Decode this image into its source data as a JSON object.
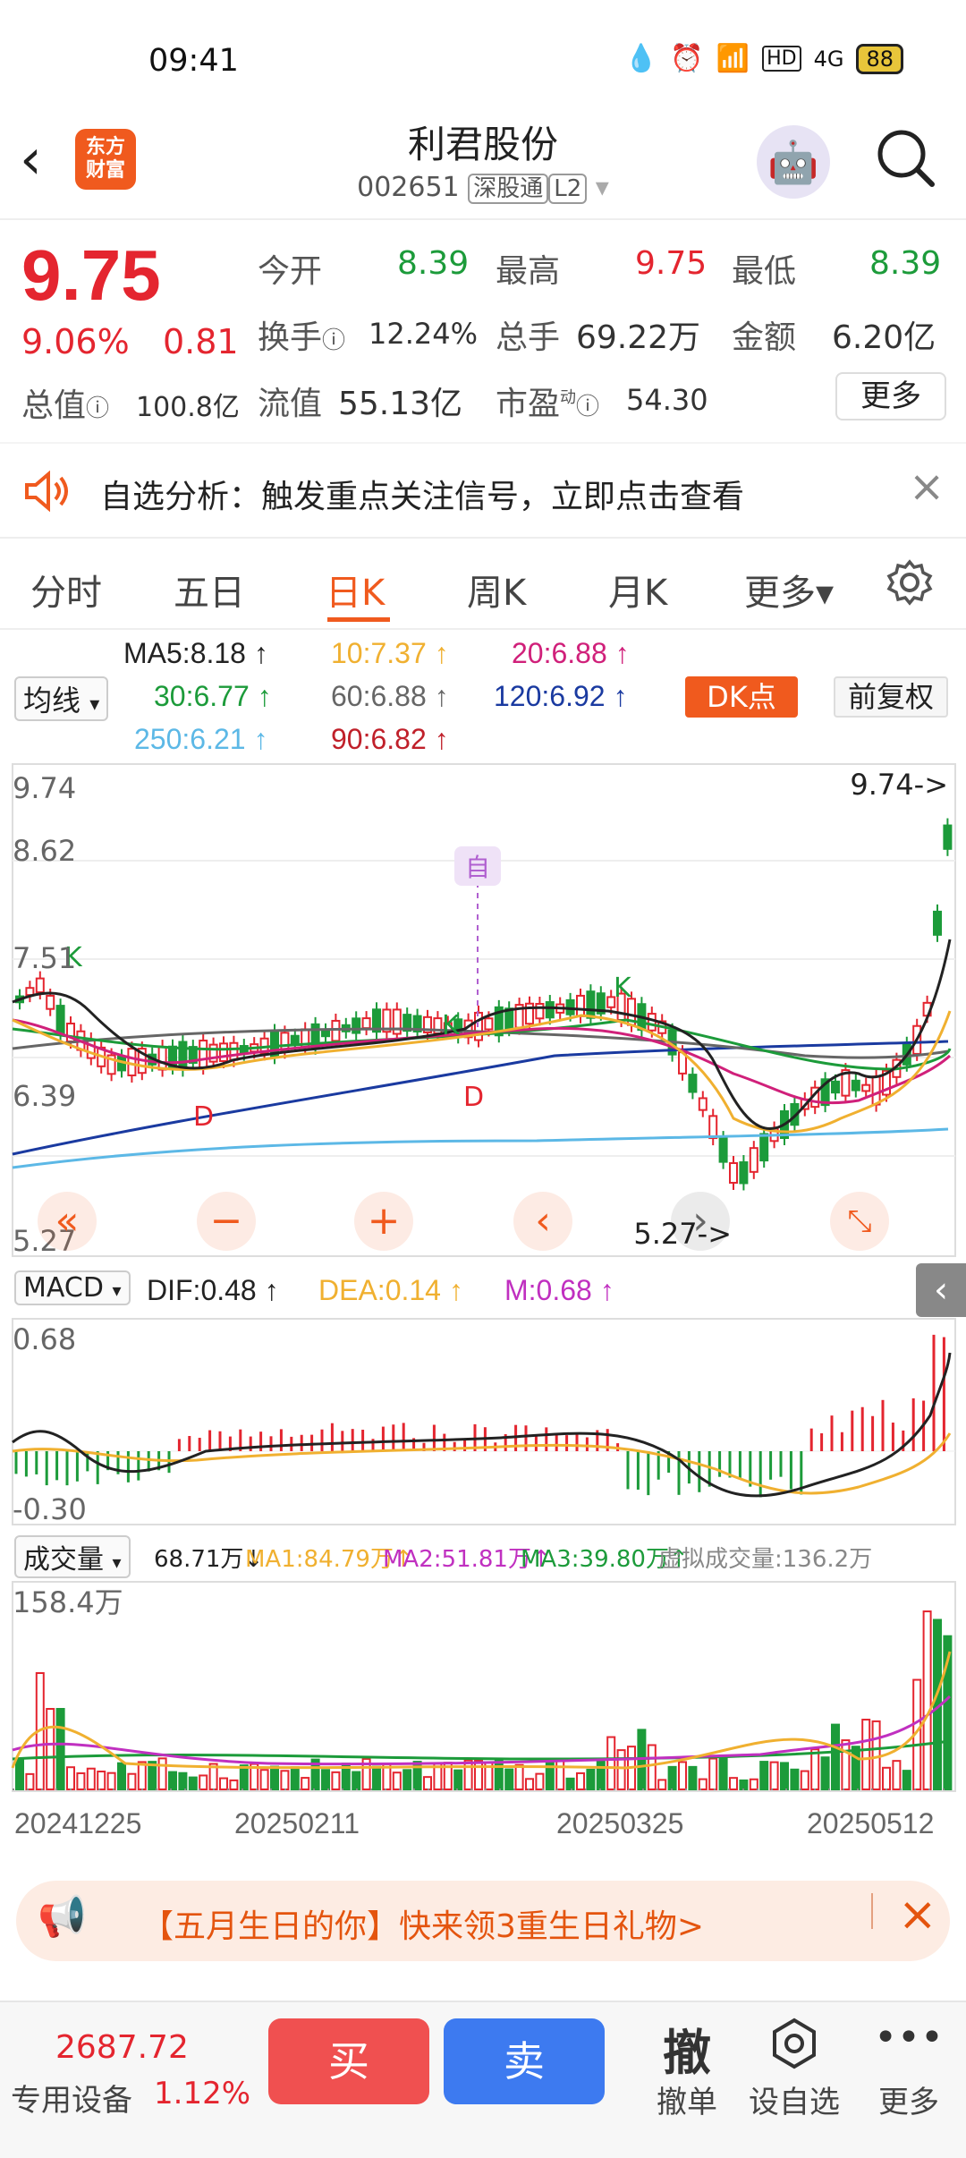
{
  "status_bar": {
    "time": "09:41",
    "battery": "88",
    "network": "4G"
  },
  "header": {
    "logo_text": "东方\n财富",
    "stock_name": "利君股份",
    "stock_code": "002651",
    "market_tag": "深股通",
    "level_tag": "L2"
  },
  "quote": {
    "price": "9.75",
    "change_pct": "9.06%",
    "change": "0.81",
    "open_label": "今开",
    "open": "8.39",
    "high_label": "最高",
    "high": "9.75",
    "low_label": "最低",
    "low": "8.39",
    "turnover_label": "换手",
    "turnover": "12.24%",
    "volume_label": "总手",
    "volume": "69.22万",
    "amount_label": "金额",
    "amount": "6.20亿",
    "total_cap_label": "总值",
    "total_cap": "100.8亿",
    "float_cap_label": "流值",
    "float_cap": "55.13亿",
    "pe_label": "市盈",
    "pe_sup": "动",
    "pe": "54.30",
    "more_label": "更多"
  },
  "notice": {
    "text": "自选分析：触发重点关注信号，立即点击查看"
  },
  "tabs": [
    {
      "label": "分时"
    },
    {
      "label": "五日"
    },
    {
      "label": "日K"
    },
    {
      "label": "周K"
    },
    {
      "label": "月K"
    },
    {
      "label": "更多▾"
    }
  ],
  "ma_legend": {
    "selector": "均线",
    "ma5": "MA5:8.18",
    "ma10": "10:7.37",
    "ma20": "20:6.88",
    "ma30": "30:6.77",
    "ma60": "60:6.88",
    "ma120": "120:6.92",
    "ma250": "250:6.21",
    "ma90": "90:6.82",
    "dk_label": "DK点",
    "adjust_label": "前复权"
  },
  "colors": {
    "ma5": "#222222",
    "ma10": "#f0b030",
    "ma20": "#d0207a",
    "ma30": "#1c9b3a",
    "ma60": "#666666",
    "ma120": "#1a3aa0",
    "ma250": "#5cb8e6",
    "ma90": "#c0202a",
    "up": "#e4252f",
    "down": "#1c9b3a",
    "accent": "#f05a1e"
  },
  "kline": {
    "y_labels": [
      "9.74",
      "8.62",
      "7.51",
      "6.39",
      "5.27"
    ],
    "max_label": "9.74->",
    "min_label": "5.27->",
    "marker_zi": "自",
    "marker_k": "K",
    "marker_d": "D"
  },
  "macd": {
    "selector": "MACD",
    "dif": "DIF:0.48",
    "dea": "DEA:0.14",
    "m": "M:0.68",
    "top": "0.68",
    "bottom": "-0.30"
  },
  "volume": {
    "selector": "成交量",
    "v": "68.71万",
    "ma1": "MA1:84.79万",
    "ma2": "MA2:51.81万",
    "ma3": "MA3:39.80万",
    "virtual": "虚拟成交量:136.2万",
    "top": "158.4万"
  },
  "dates": [
    "20241225",
    "20250211",
    "20250325",
    "20250512"
  ],
  "banner": {
    "text": "【五月生日的你】快来领3重生日礼物>"
  },
  "bottom_bar": {
    "index_value": "2687.72",
    "index_name": "专用设备",
    "index_pct": "1.12%",
    "buy_label": "买",
    "sell_label": "卖",
    "cancel_icon": "撤",
    "cancel_label": "撤单",
    "watch_label": "设自选",
    "more_label": "更多"
  }
}
